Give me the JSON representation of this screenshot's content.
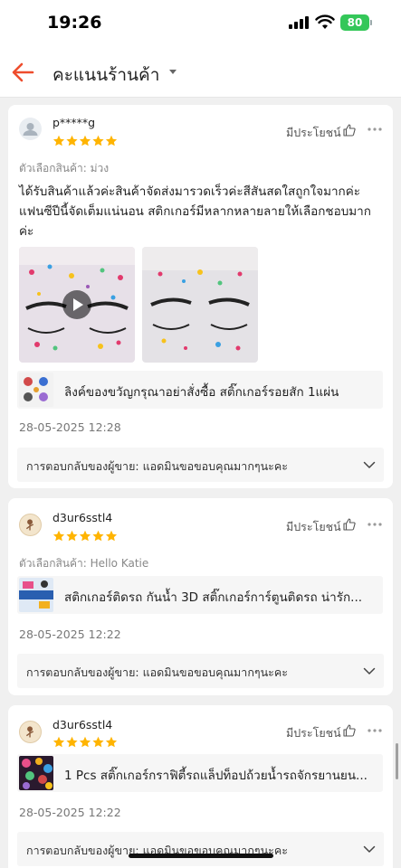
{
  "status_bar": {
    "time": "19:26",
    "battery": "80"
  },
  "header": {
    "title": "คะแนนร้านค้า"
  },
  "reviews": [
    {
      "username": "p*****g",
      "rating": 5,
      "helpful_label": "มีประโยชน์",
      "variant": "ตัวเลือกสินค้า: ม่วง",
      "text": "ได้รับสินค้าแล้วค่ะสินค้าจัดส่งมารวดเร็วค่ะสีสันสดใสถูกใจมากค่ะแฟนซีปีนี้จัดเต็มแน่นอน สติกเกอร์มีหลากหลายลายให้เลือกชอบมากค่ะ",
      "product": "ลิงค์ของขวัญกรุณาอย่าสั่งซื้อ สติ๊กเกอร์รอยสัก 1แผ่น",
      "date": "28-05-2025 12:28",
      "seller_reply_label": "การตอบกลับของผู้ขาย:",
      "seller_reply": "แอดมินขอขอบคุณมากๆนะคะ"
    },
    {
      "username": "d3ur6sstl4",
      "rating": 5,
      "helpful_label": "มีประโยชน์",
      "variant": "ตัวเลือกสินค้า: Hello Katie",
      "product": "สติกเกอร์ติดรถ กันน้ำ 3D สติ๊กเกอร์การ์ตูนติดรถ น่ารัก...",
      "date": "28-05-2025 12:22",
      "seller_reply_label": "การตอบกลับของผู้ขาย:",
      "seller_reply": "แอดมินขอขอบคุณมากๆนะคะ"
    },
    {
      "username": "d3ur6sstl4",
      "rating": 5,
      "helpful_label": "มีประโยชน์",
      "product": "1 Pcs สติ๊กเกอร์กราฟิตี้รถแล็ปท็อปถ้วยน้ำรถจักรยานยน...",
      "date": "28-05-2025 12:22",
      "seller_reply_label": "การตอบกลับของผู้ขาย:",
      "seller_reply": "แอดมินขอขอบคุณมากๆนะคะ"
    }
  ],
  "colors": {
    "accent": "#ee4d2d",
    "star": "#ffb400",
    "battery": "#34c759"
  }
}
